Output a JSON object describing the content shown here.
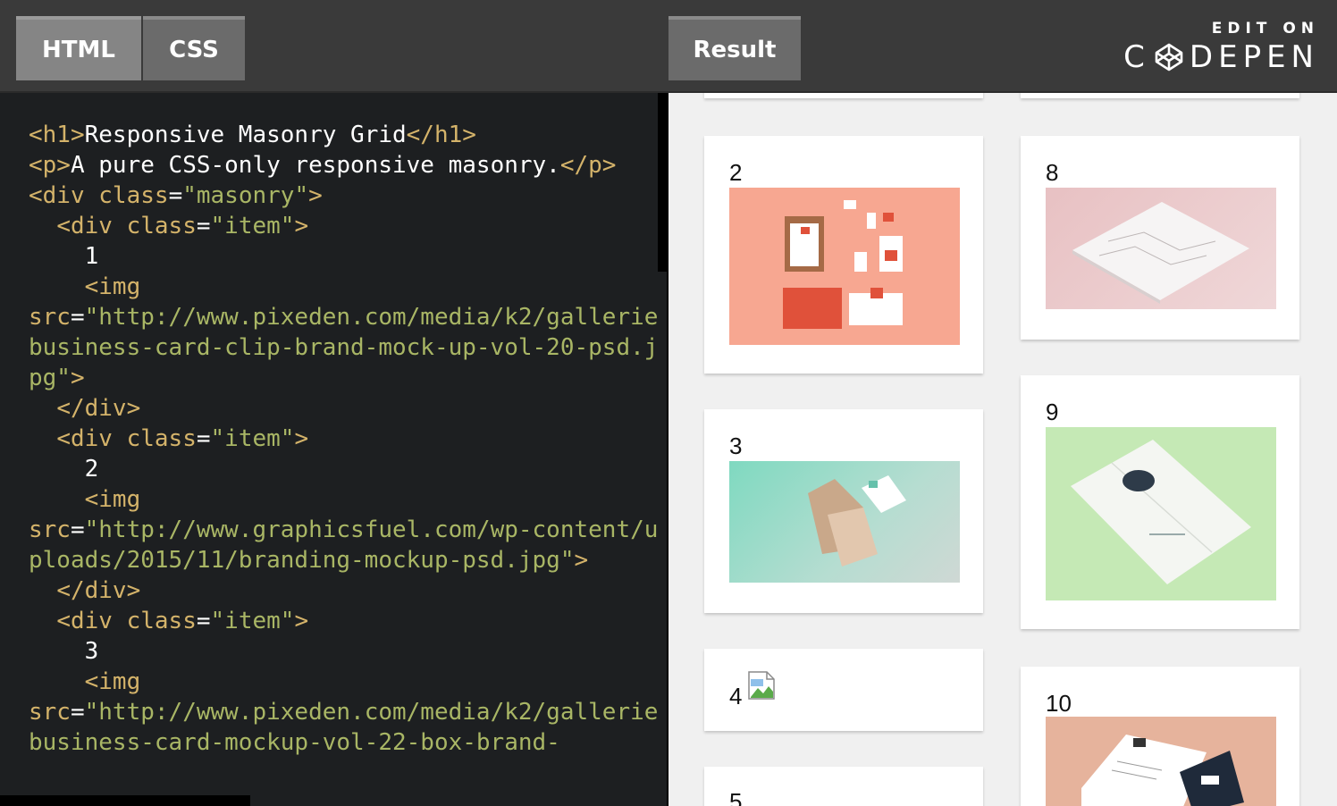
{
  "tabs": {
    "html": "HTML",
    "css": "CSS",
    "result": "Result"
  },
  "brand": {
    "line1": "EDIT ON",
    "line2_pre": "C",
    "line2_post": "DEPEN"
  },
  "code": {
    "l1_tag_open": "<h1>",
    "l1_text": "Responsive Masonry Grid",
    "l1_tag_close": "</h1>",
    "l2_tag_open": "<p>",
    "l2_text": "A pure CSS-only responsive masonry.",
    "l2_tag_close": "</p>",
    "l3_open": "<div ",
    "l3_attr": "class",
    "l3_eq": "=",
    "l3_val": "\"masonry\"",
    "l3_close": ">",
    "item_open": "<div ",
    "item_attr": "class",
    "item_eq": "=",
    "item_val": "\"item\"",
    "item_close": ">",
    "n1": "1",
    "n2": "2",
    "n3": "3",
    "img_open": "<img",
    "src_attr": "src",
    "src_eq": "=",
    "src1": "\"http://www.pixeden.com/media/k2/gallerie business-card-clip-brand-mock-up-vol-20-psd.jpg\"",
    "src2": "\"http://www.graphicsfuel.com/wp-content/uploads/2015/11/branding-mockup-psd.jpg\"",
    "src3": "\"http://www.pixeden.com/media/k2/gallerie business-card-mockup-vol-22-box-brand-",
    "gt": ">",
    "div_end": "</div>"
  },
  "result": {
    "cards": {
      "c2": "2",
      "c3": "3",
      "c4": "4",
      "c5": "5",
      "c8": "8",
      "c9": "9",
      "c10": "10"
    }
  },
  "colors": {
    "tag": "#d4b36a",
    "string": "#a9b665",
    "result_bg": "#f0f0f0",
    "editor_bg": "#1d1f21"
  }
}
